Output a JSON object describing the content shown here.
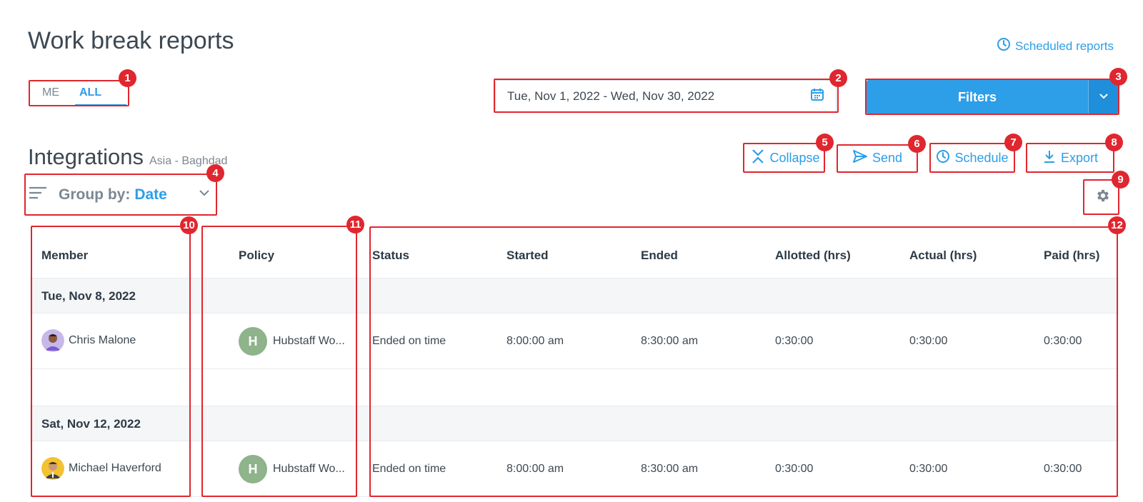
{
  "header": {
    "title": "Work break reports",
    "scheduled_reports_label": "Scheduled reports"
  },
  "scope_toggle": {
    "me_label": "ME",
    "all_label": "ALL",
    "selected": "ALL"
  },
  "date_range": {
    "value": "Tue, Nov 1, 2022 - Wed, Nov 30, 2022"
  },
  "filters": {
    "label": "Filters"
  },
  "section": {
    "title": "Integrations",
    "timezone": "Asia - Baghdad"
  },
  "actions": {
    "collapse_label": "Collapse",
    "send_label": "Send",
    "schedule_label": "Schedule",
    "export_label": "Export"
  },
  "group_by": {
    "label": "Group by:",
    "value": "Date"
  },
  "table": {
    "columns": [
      "Member",
      "Policy",
      "Status",
      "Started",
      "Ended",
      "Allotted (hrs)",
      "Actual (hrs)",
      "Paid (hrs)"
    ],
    "groups": [
      {
        "date": "Tue, Nov 8, 2022",
        "rows": [
          {
            "member": "Chris Malone",
            "policy_initial": "H",
            "policy": "Hubstaff Wo...",
            "status": "Ended on time",
            "started": "8:00:00 am",
            "ended": "8:30:00 am",
            "allotted": "0:30:00",
            "actual": "0:30:00",
            "paid": "0:30:00"
          }
        ]
      },
      {
        "date": "Sat, Nov 12, 2022",
        "rows": [
          {
            "member": "Michael Haverford",
            "policy_initial": "H",
            "policy": "Hubstaff Wo...",
            "status": "Ended on time",
            "started": "8:00:00 am",
            "ended": "8:30:00 am",
            "allotted": "0:30:00",
            "actual": "0:30:00",
            "paid": "0:30:00"
          }
        ]
      }
    ]
  },
  "annotations": [
    "1",
    "2",
    "3",
    "4",
    "5",
    "6",
    "7",
    "8",
    "9",
    "10",
    "11",
    "12"
  ],
  "colors": {
    "accent": "#2d9ee8",
    "annotation": "#e0262f",
    "policy_avatar": "#8fb38b"
  }
}
